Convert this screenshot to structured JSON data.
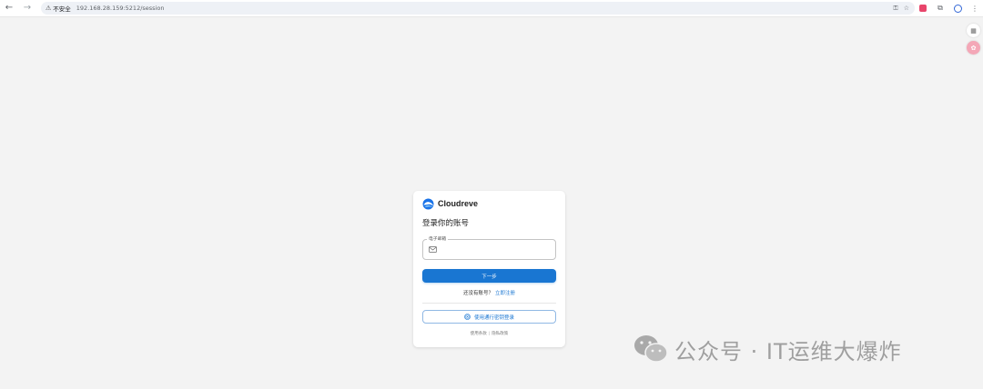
{
  "browser": {
    "nav": {
      "back_icon": "←",
      "forward_icon": "→",
      "reload_icon": "C"
    },
    "security_label": "不安全",
    "url": "192.168.28.159:5212/session"
  },
  "login": {
    "brand": "Cloudreve",
    "heading": "登录你的账号",
    "email_label": "电子邮箱",
    "email_value": "",
    "next_button": "下一步",
    "no_account_text": "还没有账号？",
    "register_link": "立即注册",
    "passkey_button": "使用通行密钥登录",
    "terms_link": "使用条款",
    "privacy_link": "隐私政策",
    "separator": "|"
  },
  "watermark": {
    "text": "公众号 · IT运维大爆炸"
  },
  "colors": {
    "primary": "#1976d2",
    "background": "#f3f3f3"
  }
}
